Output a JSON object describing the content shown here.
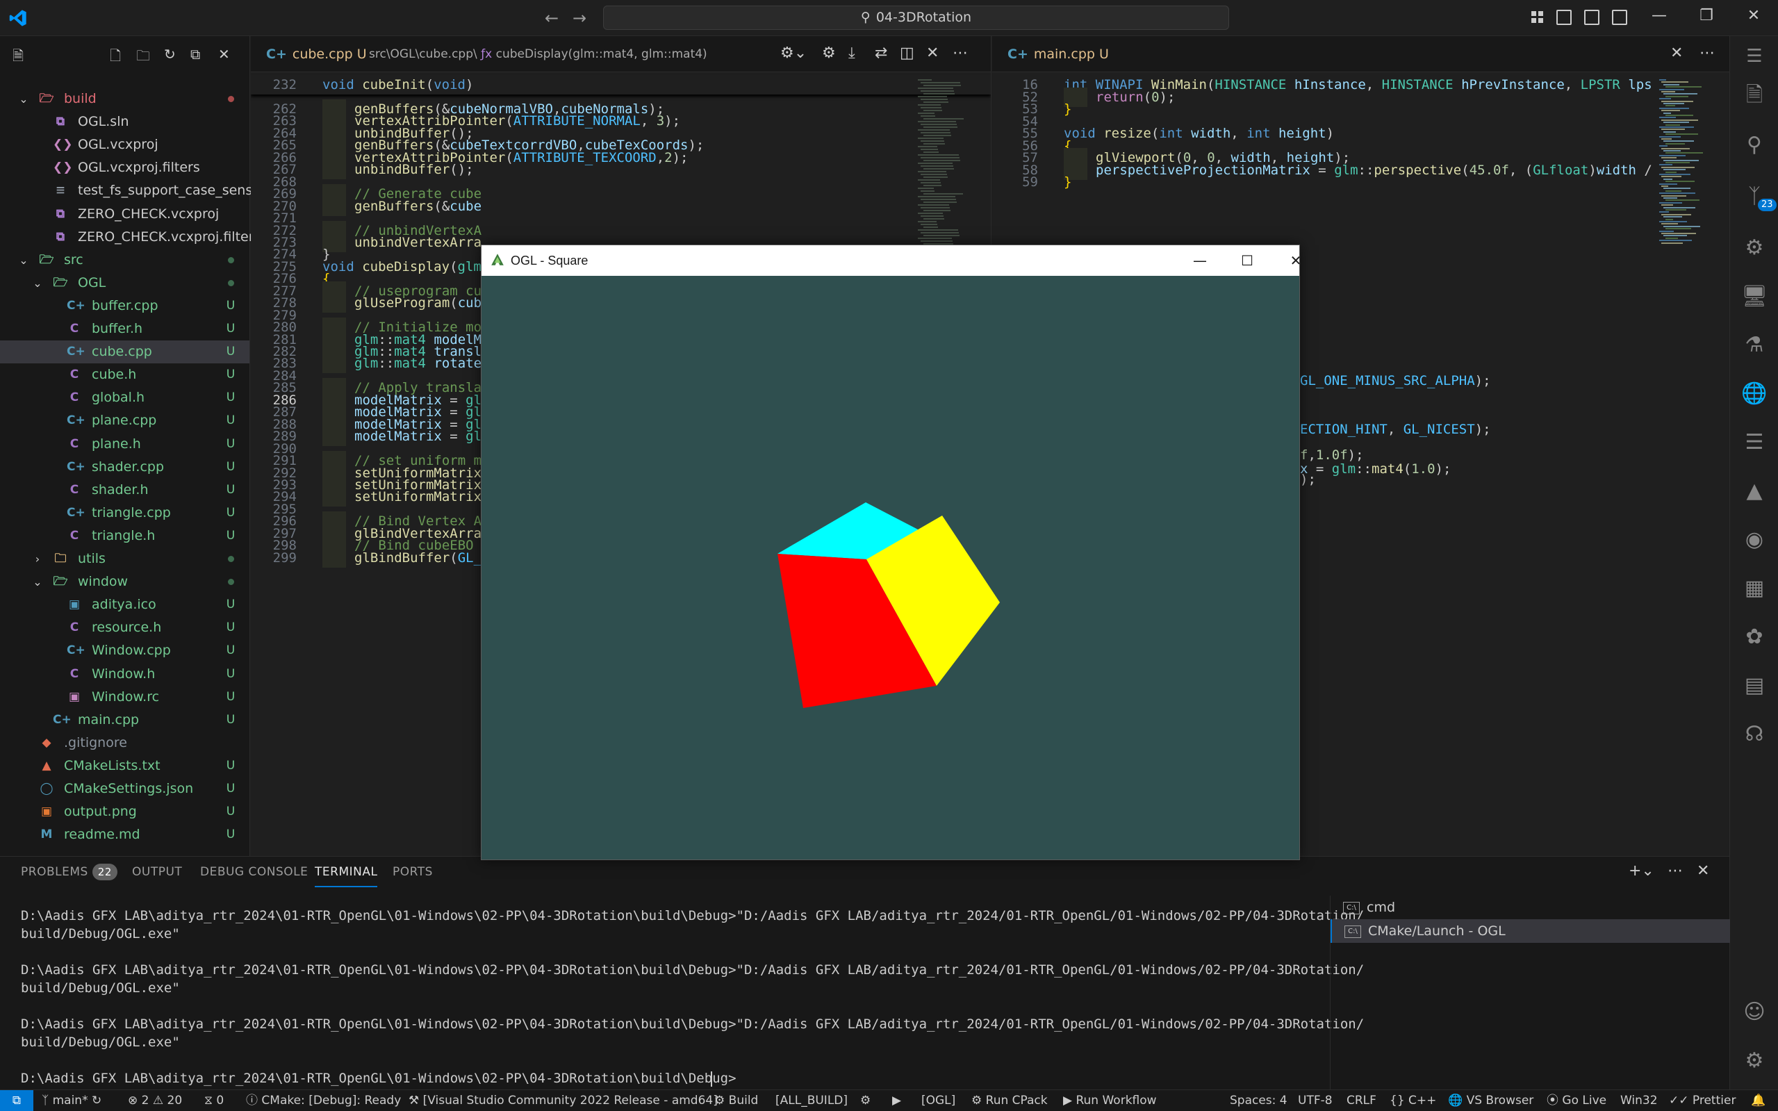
{
  "titlebar": {
    "search": "04-3DRotation",
    "back_icon": "arrow-left-icon",
    "forward_icon": "arrow-right-icon"
  },
  "explorer": {
    "rows": [
      {
        "name": "build",
        "type": "folder-open",
        "color": "#e06c75",
        "status": "dot-red",
        "depth": 0
      },
      {
        "name": "OGL.sln",
        "type": "sln",
        "color": "#cccccc",
        "status": "",
        "depth": 1
      },
      {
        "name": "OGL.vcxproj",
        "type": "vcx",
        "color": "#cccccc",
        "status": "",
        "depth": 1
      },
      {
        "name": "OGL.vcxproj.filters",
        "type": "vcx",
        "color": "#cccccc",
        "status": "",
        "depth": 1
      },
      {
        "name": "test_fs_support_case_sensitiv...",
        "type": "txt",
        "color": "#cccccc",
        "status": "",
        "depth": 1
      },
      {
        "name": "ZERO_CHECK.vcxproj",
        "type": "sln",
        "color": "#cccccc",
        "status": "",
        "depth": 1
      },
      {
        "name": "ZERO_CHECK.vcxproj.filters",
        "type": "sln",
        "color": "#cccccc",
        "status": "",
        "depth": 1
      },
      {
        "name": "src",
        "type": "folder-open",
        "color": "#73c991",
        "status": "dot-green",
        "depth": 0
      },
      {
        "name": "OGL",
        "type": "folder-open",
        "color": "#73c991",
        "status": "dot-green",
        "depth": 1
      },
      {
        "name": "buffer.cpp",
        "type": "cpp",
        "color": "#73c991",
        "status": "U",
        "depth": 2
      },
      {
        "name": "buffer.h",
        "type": "h",
        "color": "#73c991",
        "status": "U",
        "depth": 2
      },
      {
        "name": "cube.cpp",
        "type": "cpp",
        "color": "#73c991",
        "status": "U",
        "depth": 2,
        "selected": true
      },
      {
        "name": "cube.h",
        "type": "h",
        "color": "#73c991",
        "status": "U",
        "depth": 2
      },
      {
        "name": "global.h",
        "type": "h",
        "color": "#73c991",
        "status": "U",
        "depth": 2
      },
      {
        "name": "plane.cpp",
        "type": "cpp",
        "color": "#73c991",
        "status": "U",
        "depth": 2
      },
      {
        "name": "plane.h",
        "type": "h",
        "color": "#73c991",
        "status": "U",
        "depth": 2
      },
      {
        "name": "shader.cpp",
        "type": "cpp",
        "color": "#73c991",
        "status": "U",
        "depth": 2
      },
      {
        "name": "shader.h",
        "type": "h",
        "color": "#73c991",
        "status": "U",
        "depth": 2
      },
      {
        "name": "triangle.cpp",
        "type": "cpp",
        "color": "#73c991",
        "status": "U",
        "depth": 2
      },
      {
        "name": "triangle.h",
        "type": "h",
        "color": "#73c991",
        "status": "U",
        "depth": 2
      },
      {
        "name": "utils",
        "type": "folder-closed",
        "color": "#73c991",
        "status": "dot-green",
        "depth": 1
      },
      {
        "name": "window",
        "type": "folder-open",
        "color": "#73c991",
        "status": "dot-green",
        "depth": 1
      },
      {
        "name": "aditya.ico",
        "type": "ico",
        "color": "#73c991",
        "status": "U",
        "depth": 2
      },
      {
        "name": "resource.h",
        "type": "h",
        "color": "#73c991",
        "status": "U",
        "depth": 2
      },
      {
        "name": "Window.cpp",
        "type": "cpp",
        "color": "#73c991",
        "status": "U",
        "depth": 2
      },
      {
        "name": "Window.h",
        "type": "h",
        "color": "#73c991",
        "status": "U",
        "depth": 2
      },
      {
        "name": "Window.rc",
        "type": "rc",
        "color": "#73c991",
        "status": "U",
        "depth": 2
      },
      {
        "name": "main.cpp",
        "type": "cpp",
        "color": "#73c991",
        "status": "U",
        "depth": 1
      },
      {
        "name": ".gitignore",
        "type": "git",
        "color": "#8b949e",
        "status": "",
        "depth": 0
      },
      {
        "name": "CMakeLists.txt",
        "type": "cmake",
        "color": "#73c991",
        "status": "U",
        "depth": 0
      },
      {
        "name": "CMakeSettings.json",
        "type": "json",
        "color": "#73c991",
        "status": "U",
        "depth": 0
      },
      {
        "name": "output.png",
        "type": "png",
        "color": "#73c991",
        "status": "U",
        "depth": 0
      },
      {
        "name": "readme.md",
        "type": "md",
        "color": "#73c991",
        "status": "U",
        "depth": 0
      }
    ]
  },
  "editor_left": {
    "tab_label": "cube.cpp",
    "tab_status": "U",
    "breadcrumb": "src\\OGL\\cube.cpp\\",
    "breadcrumb_fn": "cubeDisplay(glm::mat4, glm::mat4)",
    "sticky_line": {
      "num": "232",
      "html": "<span class='k'>void</span> <span class='f'>cubeInit</span>(<span class='k'>void</span>)"
    },
    "current_line": "286",
    "lines": [
      {
        "num": "262",
        "indent": 1,
        "html": "<span class='f'>genBuffers</span>(&amp;<span class='p'>cubeNormalVBO</span>,<span class='p'>cubeNormals</span>);"
      },
      {
        "num": "263",
        "indent": 1,
        "html": "<span class='f'>vertexAttribPointer</span>(<span class='cst'>ATTRIBUTE_NORMAL</span>, <span class='n'>3</span>);"
      },
      {
        "num": "264",
        "indent": 1,
        "html": "<span class='f'>unbindBuffer</span>();"
      },
      {
        "num": "265",
        "indent": 1,
        "html": "<span class='f'>genBuffers</span>(&amp;<span class='p'>cubeTextcorrdVBO</span>,<span class='p'>cubeTexCoords</span>);"
      },
      {
        "num": "266",
        "indent": 1,
        "html": "<span class='f'>vertexAttribPointer</span>(<span class='cst'>ATTRIBUTE_TEXCOORD</span>,<span class='n'>2</span>);"
      },
      {
        "num": "267",
        "indent": 1,
        "html": "<span class='f'>unbindBuffer</span>();"
      },
      {
        "num": "268",
        "indent": 0,
        "html": ""
      },
      {
        "num": "269",
        "indent": 1,
        "html": "<span class='c'>// Generate cube</span>"
      },
      {
        "num": "270",
        "indent": 1,
        "html": "<span class='f'>genBuffers</span>(&amp;<span class='p'>cube</span>"
      },
      {
        "num": "271",
        "indent": 0,
        "html": ""
      },
      {
        "num": "272",
        "indent": 1,
        "html": "<span class='c'>// unbindVertexA</span>"
      },
      {
        "num": "273",
        "indent": 1,
        "html": "<span class='f'>unbindVertexArra</span>"
      },
      {
        "num": "274",
        "indent": 0,
        "html": "}"
      },
      {
        "num": "275",
        "indent": 0,
        "html": "<span class='k'>void</span> <span class='f'>cubeDisplay</span>(<span class='t'>glm</span>"
      },
      {
        "num": "276",
        "indent": 0,
        "html": "<span style='color:#ffd700'>{</span>"
      },
      {
        "num": "277",
        "indent": 1,
        "html": "<span class='c'>// useprogram cu</span>"
      },
      {
        "num": "278",
        "indent": 1,
        "html": "<span class='f'>glUseProgram</span>(<span class='p'>cub</span>"
      },
      {
        "num": "279",
        "indent": 0,
        "html": ""
      },
      {
        "num": "280",
        "indent": 1,
        "html": "<span class='c'>// Initialize mo</span>"
      },
      {
        "num": "281",
        "indent": 1,
        "html": "<span class='t'>glm</span>::<span class='t'>mat4</span> <span class='p'>modelM</span>"
      },
      {
        "num": "282",
        "indent": 1,
        "html": "<span class='t'>glm</span>::<span class='t'>mat4</span> <span class='p'>transl</span>"
      },
      {
        "num": "283",
        "indent": 1,
        "html": "<span class='t'>glm</span>::<span class='t'>mat4</span> <span class='p'>rotate</span>"
      },
      {
        "num": "284",
        "indent": 0,
        "html": ""
      },
      {
        "num": "285",
        "indent": 1,
        "html": "<span class='c'>// Apply transla</span>"
      },
      {
        "num": "286",
        "indent": 1,
        "html": "<span class='p'>modelMatrix</span> = <span class='t'>gl</span>"
      },
      {
        "num": "287",
        "indent": 1,
        "html": "<span class='p'>modelMatrix</span> = <span class='t'>gl</span>"
      },
      {
        "num": "288",
        "indent": 1,
        "html": "<span class='p'>modelMatrix</span> = <span class='t'>gl</span>"
      },
      {
        "num": "289",
        "indent": 1,
        "html": "<span class='p'>modelMatrix</span> = <span class='t'>gl</span>"
      },
      {
        "num": "290",
        "indent": 0,
        "html": ""
      },
      {
        "num": "291",
        "indent": 1,
        "html": "<span class='c'>// set uniform m</span>"
      },
      {
        "num": "292",
        "indent": 1,
        "html": "<span class='f'>setUniformMatrix</span>"
      },
      {
        "num": "293",
        "indent": 1,
        "html": "<span class='f'>setUniformMatrix</span>"
      },
      {
        "num": "294",
        "indent": 1,
        "html": "<span class='f'>setUniformMatrix</span>"
      },
      {
        "num": "295",
        "indent": 0,
        "html": ""
      },
      {
        "num": "296",
        "indent": 1,
        "html": "<span class='c'>// Bind Vertex A</span>"
      },
      {
        "num": "297",
        "indent": 1,
        "html": "<span class='f'>glBindVertexArra</span>"
      },
      {
        "num": "298",
        "indent": 1,
        "html": "<span class='c'>// Bind cubeEBO</span>"
      },
      {
        "num": "299",
        "indent": 1,
        "html": "<span class='f'>glBindBuffer</span>(<span class='cst'>GL_</span>"
      }
    ]
  },
  "editor_right": {
    "tab_label": "main.cpp",
    "tab_status": "U",
    "sticky": [
      {
        "num": "16",
        "html": "<span class='k'>int</span> <span class='k'>WINAPI</span> <span class='f'>WinMain</span>(<span class='t'>HINSTANCE</span> <span class='p'>hInstance</span>, <span class='t'>HINSTANCE</span> <span class='p'>hPrevInstance</span>, <span class='t'>LPSTR</span> <span class='p'>lps</span>"
      }
    ],
    "lines": [
      {
        "num": "52",
        "indent": 1,
        "html": "<span style='color:#c586c0'>return</span>(<span class='n'>0</span>);"
      },
      {
        "num": "53",
        "indent": 0,
        "html": "<span style='color:#ffd700'>}</span>"
      },
      {
        "num": "54",
        "indent": 0,
        "html": ""
      },
      {
        "num": "55",
        "indent": 0,
        "html": "<span class='k'>void</span> <span class='f'>resize</span>(<span class='k'>int</span> <span class='p'>width</span>, <span class='k'>int</span> <span class='p'>height</span>)"
      },
      {
        "num": "56",
        "indent": 0,
        "html": "<span style='color:#ffd700'>{</span>"
      },
      {
        "num": "57",
        "indent": 1,
        "html": "<span class='f'>glViewport</span>(<span class='n'>0</span>, <span class='n'>0</span>, <span class='p'>width</span>, <span class='p'>height</span>);"
      },
      {
        "num": "58",
        "indent": 1,
        "html": "<span class='p'>perspectiveProjectionMatrix</span> = <span class='t'>glm</span>::<span class='f'>perspective</span>(<span class='n'>45.0f</span>, (<span class='t'>GLfloat</span>)<span class='p'>width</span> /"
      },
      {
        "num": "59",
        "indent": 0,
        "html": "<span style='color:#ffd700'>}</span>"
      }
    ],
    "visible_fragments": [
      {
        "html": "<span class='cst'>GL_ONE_MINUS_SRC_ALPHA</span>);"
      },
      {
        "html": "<span class='cst'>ECTION_HINT</span>, <span class='cst'>GL_NICEST</span>);"
      },
      {
        "html": "<span class='n'>f</span>,<span class='n'>1.0f</span>);"
      },
      {
        "html": "<span class='p'>x</span> = <span class='t'>glm</span>::<span class='f'>mat4</span>(<span class='n'>1.0</span>);"
      },
      {
        "html": ");"
      }
    ]
  },
  "ogl_window": {
    "title": "OGL - Square",
    "bg_color": "#2f4f4f",
    "cube_colors": {
      "left": "#ff0000",
      "right": "#ffff00",
      "top": "#00ffff"
    }
  },
  "panel": {
    "tabs": [
      {
        "label": "PROBLEMS",
        "badge": "22"
      },
      {
        "label": "OUTPUT"
      },
      {
        "label": "DEBUG CONSOLE"
      },
      {
        "label": "TERMINAL",
        "active": true
      },
      {
        "label": "PORTS"
      }
    ],
    "terminal_lines": [
      "D:\\Aadis GFX LAB\\aditya_rtr_2024\\01-RTR_OpenGL\\01-Windows\\02-PP\\04-3DRotation\\build\\Debug>\"D:/Aadis GFX LAB/aditya_rtr_2024/01-RTR_OpenGL/01-Windows/02-PP/04-3DRotation/",
      "build/Debug/OGL.exe\"",
      "",
      "D:\\Aadis GFX LAB\\aditya_rtr_2024\\01-RTR_OpenGL\\01-Windows\\02-PP\\04-3DRotation\\build\\Debug>\"D:/Aadis GFX LAB/aditya_rtr_2024/01-RTR_OpenGL/01-Windows/02-PP/04-3DRotation/",
      "build/Debug/OGL.exe\"",
      "",
      "D:\\Aadis GFX LAB\\aditya_rtr_2024\\01-RTR_OpenGL\\01-Windows\\02-PP\\04-3DRotation\\build\\Debug>\"D:/Aadis GFX LAB/aditya_rtr_2024/01-RTR_OpenGL/01-Windows/02-PP/04-3DRotation/",
      "build/Debug/OGL.exe\"",
      "",
      "D:\\Aadis GFX LAB\\aditya_rtr_2024\\01-RTR_OpenGL\\01-Windows\\02-PP\\04-3DRotation\\build\\Debug>"
    ],
    "terminals": [
      {
        "label": "cmd"
      },
      {
        "label": "CMake/Launch - OGL",
        "active": true
      }
    ]
  },
  "statusbar": {
    "branch": "main*",
    "errors": "2",
    "warnings": "20",
    "ports": "0",
    "cmake_status": "CMake: [Debug]: Ready",
    "kit": "[Visual Studio Community 2022 Release - amd64]",
    "build": "Build",
    "target": "[ALL_BUILD]",
    "launch_target": "[OGL]",
    "cpack": "Run CPack",
    "workflow": "Run Workflow",
    "spaces": "Spaces: 4",
    "encoding": "UTF-8",
    "eol": "CRLF",
    "language": "C++",
    "browser": "VS Browser",
    "golive": "Go Live",
    "platform": "Win32",
    "prettier": "Prettier"
  },
  "activity": {
    "scm_badge": "23"
  }
}
